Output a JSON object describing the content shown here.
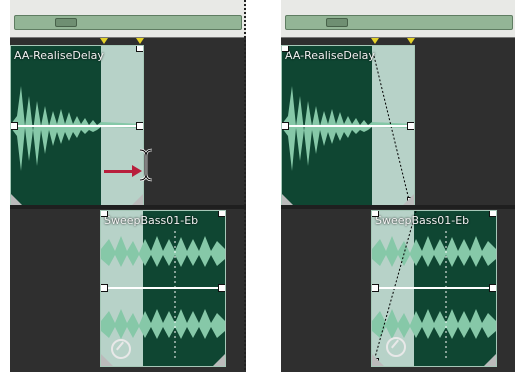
{
  "panels": [
    {
      "clip_top_name": "AA-RealiseDelay",
      "clip_bottom_name": "SweepBass01-Eb"
    },
    {
      "clip_top_name": "AA-RealiseDelay",
      "clip_bottom_name": "SweepBass01-Eb"
    }
  ],
  "icons": {
    "stretch": "timestretch-icon",
    "cursor": "ibeam-cursor-icon",
    "arrow": "right-arrow-icon"
  },
  "colors": {
    "clip_dark": "#0f4632",
    "clip_selection": "#cfe6dd",
    "arrow": "#b81f3c",
    "marker": "#e4d22b"
  }
}
